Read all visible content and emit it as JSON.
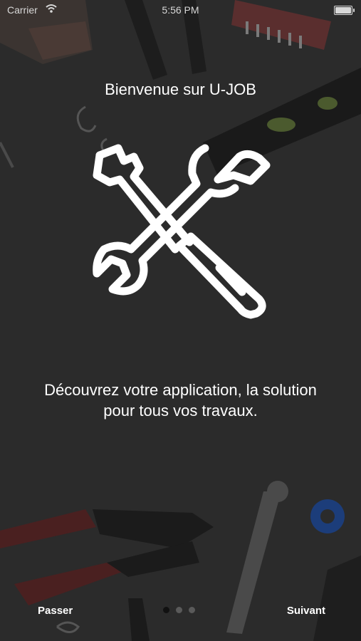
{
  "status_bar": {
    "carrier": "Carrier",
    "time": "5:56 PM"
  },
  "onboarding": {
    "title": "Bienvenue sur U-JOB",
    "logo_icon": "tools-wrench-screwdriver-icon",
    "description_line1": "Découvrez votre application, la solution",
    "description_line2": "pour tous vos travaux.",
    "page_count": 3,
    "current_page": 1
  },
  "footer": {
    "skip_label": "Passer",
    "next_label": "Suivant"
  },
  "colors": {
    "background": "#2a2a2a",
    "text": "#ffffff",
    "dot_active": "#111111",
    "dot_inactive": "#5a5a5a"
  }
}
